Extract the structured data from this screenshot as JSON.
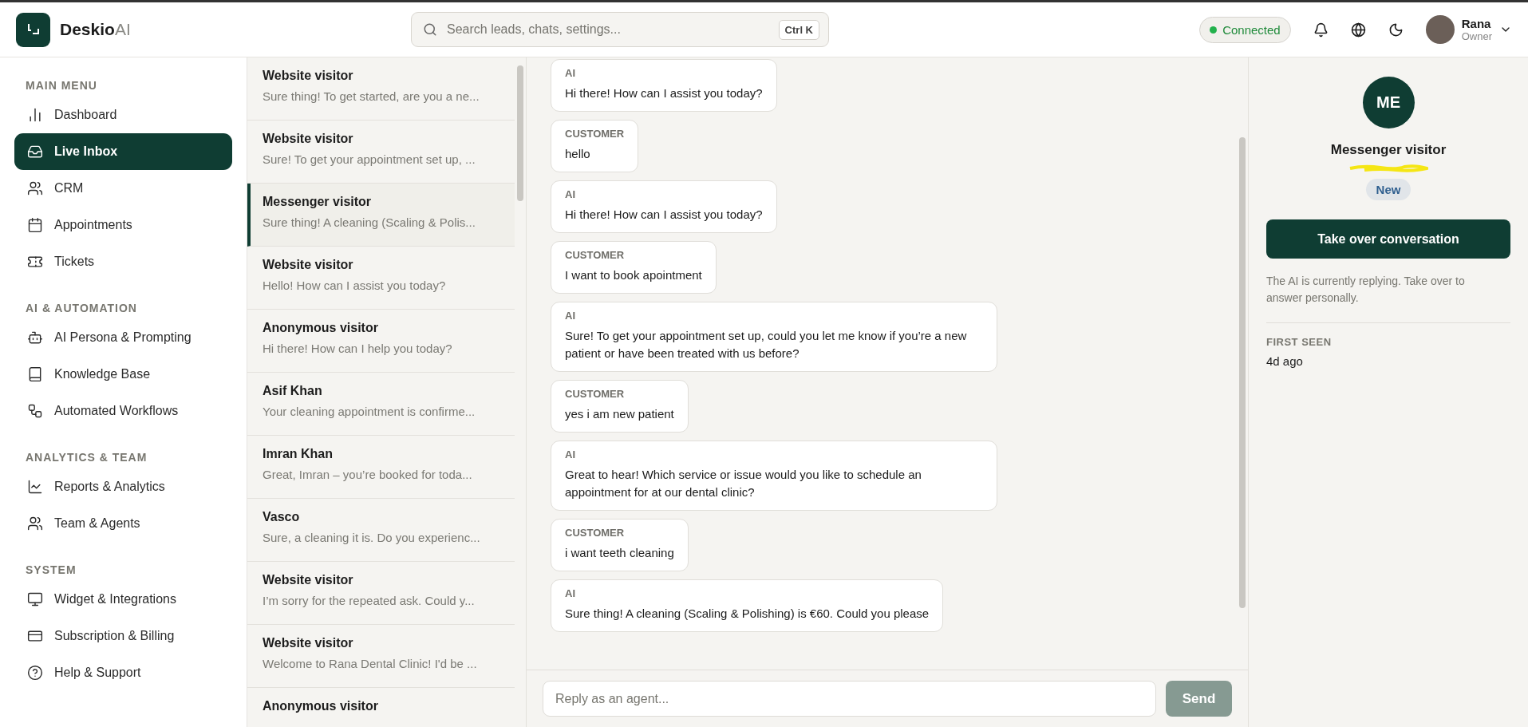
{
  "brand": {
    "name": "Deskio",
    "suffix": "AI"
  },
  "search": {
    "placeholder": "Search leads, chats, settings...",
    "shortcut": "Ctrl K"
  },
  "status": {
    "label": "Connected",
    "online": true
  },
  "user": {
    "name": "Rana",
    "role": "Owner"
  },
  "sidebar": {
    "sections": [
      {
        "title": "MAIN MENU",
        "items": [
          {
            "label": "Dashboard",
            "selected": false
          },
          {
            "label": "Live Inbox",
            "selected": true
          },
          {
            "label": "CRM",
            "selected": false
          },
          {
            "label": "Appointments",
            "selected": false
          },
          {
            "label": "Tickets",
            "selected": false
          }
        ]
      },
      {
        "title": "AI & AUTOMATION",
        "items": [
          {
            "label": "AI Persona & Prompting",
            "selected": false
          },
          {
            "label": "Knowledge Base",
            "selected": false
          },
          {
            "label": "Automated Workflows",
            "selected": false
          }
        ]
      },
      {
        "title": "ANALYTICS & TEAM",
        "items": [
          {
            "label": "Reports & Analytics",
            "selected": false
          },
          {
            "label": "Team & Agents",
            "selected": false
          }
        ]
      },
      {
        "title": "SYSTEM",
        "items": [
          {
            "label": "Widget & Integrations",
            "selected": false
          },
          {
            "label": "Subscription & Billing",
            "selected": false
          },
          {
            "label": "Help & Support",
            "selected": false
          }
        ]
      }
    ]
  },
  "conversations": [
    {
      "name": "Website visitor",
      "preview": "Sure thing! To get started, are you a ne...",
      "selected": false
    },
    {
      "name": "Website visitor",
      "preview": "Sure! To get your appointment set up, ...",
      "selected": false
    },
    {
      "name": "Messenger visitor",
      "preview": "Sure thing! A cleaning (Scaling & Polis...",
      "selected": true
    },
    {
      "name": "Website visitor",
      "preview": "Hello! How can I assist you today?",
      "selected": false
    },
    {
      "name": "Anonymous visitor",
      "preview": "Hi there! How can I help you today?",
      "selected": false
    },
    {
      "name": "Asif Khan",
      "preview": "Your cleaning appointment is confirme...",
      "selected": false
    },
    {
      "name": "Imran Khan",
      "preview": "Great, Imran – you’re booked for toda...",
      "selected": false
    },
    {
      "name": "Vasco",
      "preview": "Sure, a cleaning it is. Do you experienc...",
      "selected": false
    },
    {
      "name": "Website visitor",
      "preview": "I’m sorry for the repeated ask. Could y...",
      "selected": false
    },
    {
      "name": "Website visitor",
      "preview": "Welcome to Rana Dental Clinic! I'd be ...",
      "selected": false
    },
    {
      "name": "Anonymous visitor",
      "selected": false
    }
  ],
  "messages": [
    {
      "sender": "AI",
      "text": "Hi there! How can I assist you today?"
    },
    {
      "sender": "CUSTOMER",
      "text": "hello"
    },
    {
      "sender": "AI",
      "text": "Hi there! How can I assist you today?"
    },
    {
      "sender": "CUSTOMER",
      "text": "I want to book apointment"
    },
    {
      "sender": "AI",
      "text": "Sure! To get your appointment set up, could you let me know if you’re a new patient or have been treated with us before?"
    },
    {
      "sender": "CUSTOMER",
      "text": "yes i am new patient"
    },
    {
      "sender": "AI",
      "text": "Great to hear! Which service or issue would you like to schedule an appointment for at our dental clinic?"
    },
    {
      "sender": "CUSTOMER",
      "text": "i want teeth cleaning"
    },
    {
      "sender": "AI",
      "text": "Sure thing! A cleaning (Scaling & Polishing) is €60. Could you please"
    }
  ],
  "composer": {
    "placeholder": "Reply as an agent...",
    "send": "Send",
    "disabled": true
  },
  "contact": {
    "initials": "ME",
    "name": "Messenger visitor",
    "badge": "New",
    "action": "Take over conversation",
    "note": "The AI is currently replying. Take over to answer personally.",
    "fields": [
      {
        "label": "FIRST SEEN",
        "value": "4d ago"
      }
    ]
  }
}
